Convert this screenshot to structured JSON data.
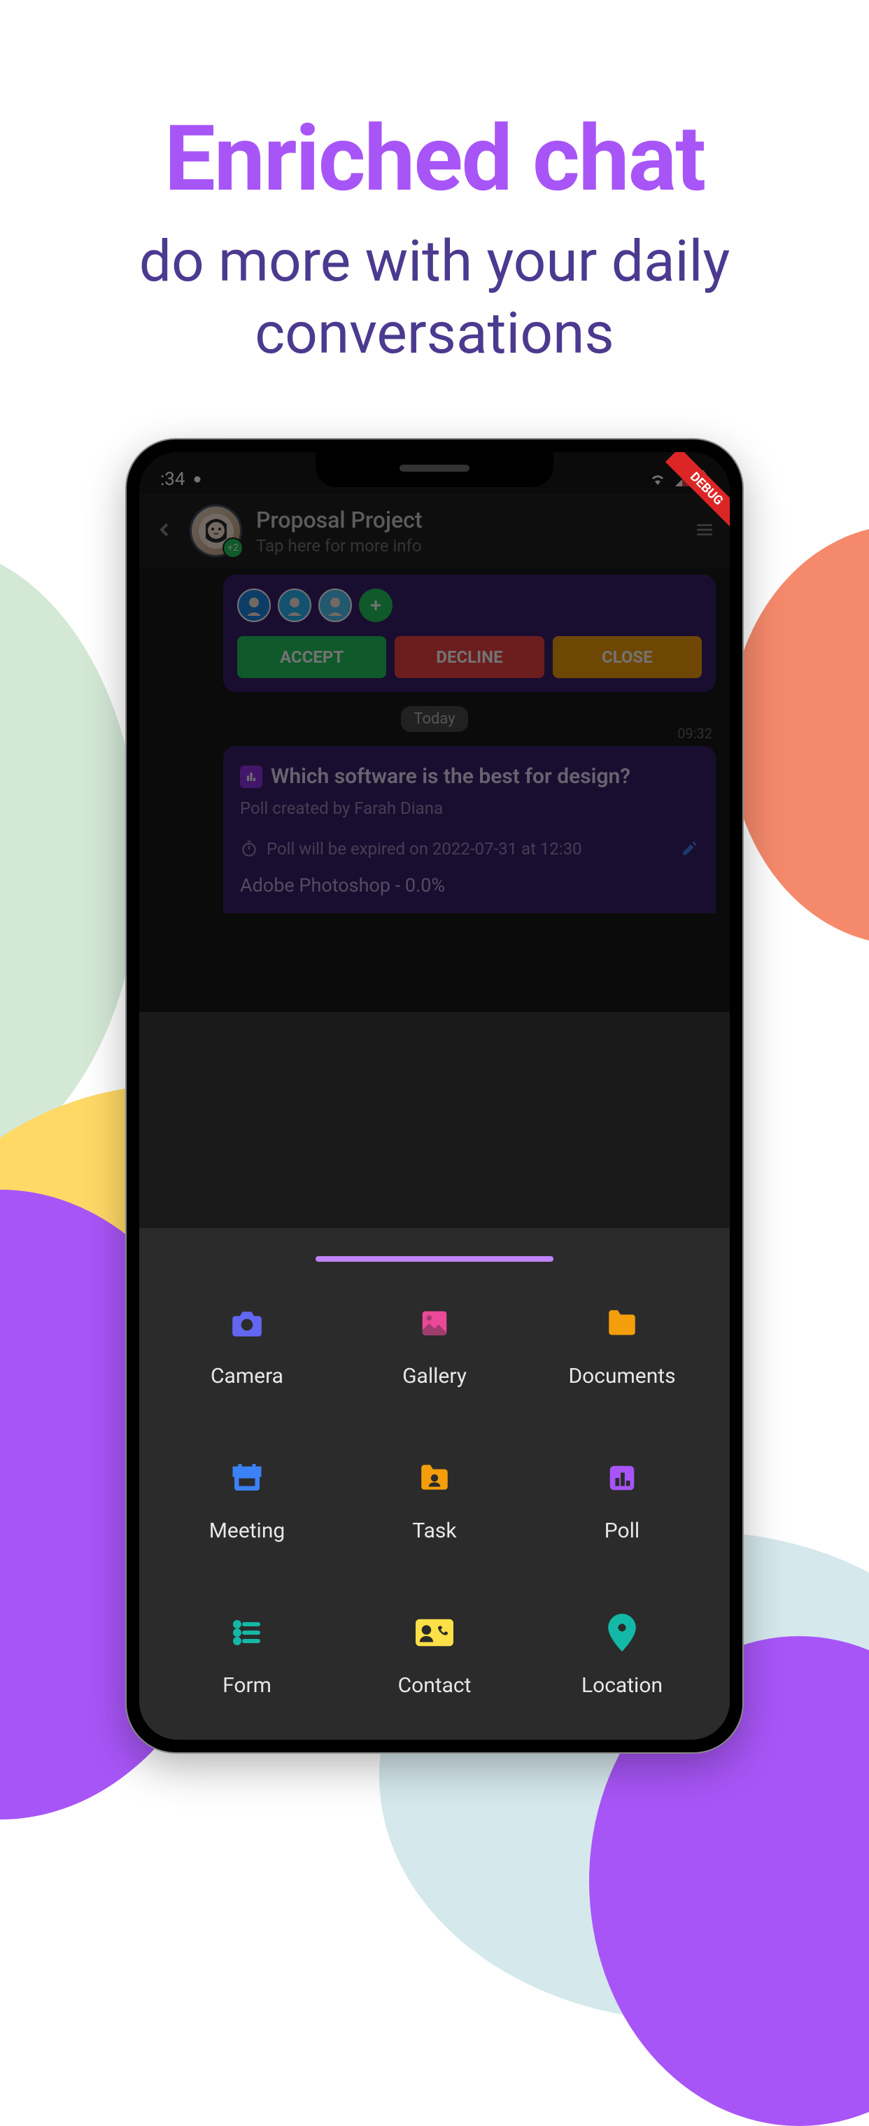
{
  "headline": {
    "title": "Enriched chat",
    "subtitle": "do more with your daily conversations"
  },
  "status": {
    "time": ":34",
    "debug_ribbon": "DEBUG"
  },
  "chat_header": {
    "title": "Proposal Project",
    "subtitle": "Tap here for more info",
    "badge": "+2"
  },
  "invite_card": {
    "actions": {
      "accept": "ACCEPT",
      "decline": "DECLINE",
      "close": "CLOSE"
    }
  },
  "date_divider": "Today",
  "poll": {
    "time": "09:32",
    "question": "Which software is the best for design?",
    "creator": "Poll created by Farah Diana",
    "expiry": "Poll will be expired on 2022-07-31 at 12:30",
    "option1": "Adobe Photoshop - 0.0%"
  },
  "sheet": {
    "items": [
      {
        "label": "Camera",
        "icon": "camera",
        "color": "#6366f1"
      },
      {
        "label": "Gallery",
        "icon": "image",
        "color": "#ec4899"
      },
      {
        "label": "Documents",
        "icon": "folder",
        "color": "#f59e0b"
      },
      {
        "label": "Meeting",
        "icon": "calendar",
        "color": "#3b82f6"
      },
      {
        "label": "Task",
        "icon": "folder-user",
        "color": "#f59e0b"
      },
      {
        "label": "Poll",
        "icon": "poll",
        "color": "#a855f7"
      },
      {
        "label": "Form",
        "icon": "list",
        "color": "#14b8a6"
      },
      {
        "label": "Contact",
        "icon": "contact",
        "color": "#fde047"
      },
      {
        "label": "Location",
        "icon": "pin",
        "color": "#14b8a6"
      }
    ]
  }
}
